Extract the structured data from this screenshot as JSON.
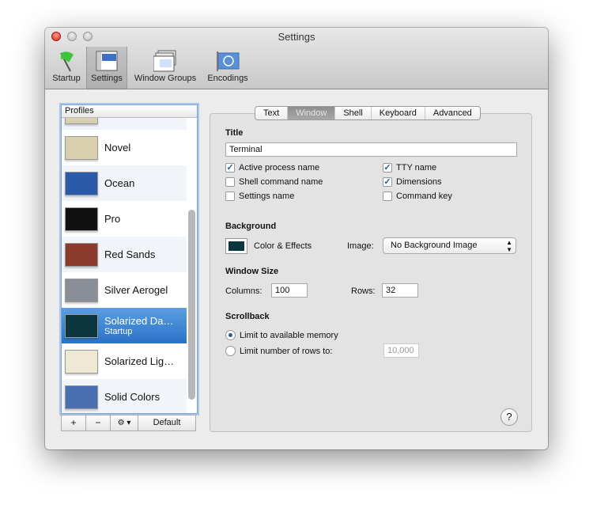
{
  "window": {
    "title": "Settings"
  },
  "toolbar": [
    {
      "label": "Startup",
      "icon": "flag-icon"
    },
    {
      "label": "Settings",
      "icon": "settings-icon",
      "selected": true
    },
    {
      "label": "Window Groups",
      "icon": "window-groups-icon"
    },
    {
      "label": "Encodings",
      "icon": "un-flag-icon"
    }
  ],
  "profiles": {
    "header": "Profiles",
    "items": [
      {
        "name": "",
        "color": "#d8cfae"
      },
      {
        "name": "Novel",
        "color": "#d8cfae"
      },
      {
        "name": "Ocean",
        "color": "#2b5aa8"
      },
      {
        "name": "Pro",
        "color": "#111111"
      },
      {
        "name": "Red Sands",
        "color": "#8c3a2b"
      },
      {
        "name": "Silver Aerogel",
        "color": "#8a8e96"
      },
      {
        "name": "Solarized Da…",
        "sub": "Startup",
        "color": "#0b3640",
        "selected": true
      },
      {
        "name": "Solarized Lig…",
        "color": "#eee8d5"
      },
      {
        "name": "Solid Colors",
        "color": "#4a6fb0"
      }
    ],
    "buttons": {
      "add": "+",
      "remove": "−",
      "gear": "⚙ ▾",
      "default": "Default"
    }
  },
  "tabs": [
    {
      "label": "Text"
    },
    {
      "label": "Window",
      "selected": true
    },
    {
      "label": "Shell"
    },
    {
      "label": "Keyboard"
    },
    {
      "label": "Advanced"
    }
  ],
  "window_tab": {
    "title_heading": "Title",
    "title_value": "Terminal",
    "checks": [
      {
        "label": "Active process name",
        "checked": true
      },
      {
        "label": "Shell command name",
        "checked": false
      },
      {
        "label": "Settings name",
        "checked": false
      },
      {
        "label": "TTY name",
        "checked": true
      },
      {
        "label": "Dimensions",
        "checked": true
      },
      {
        "label": "Command key",
        "checked": false
      }
    ],
    "background_heading": "Background",
    "color_effects": "Color & Effects",
    "swatch_color": "#0b3640",
    "image_label": "Image:",
    "image_value": "No Background Image",
    "size_heading": "Window Size",
    "columns_label": "Columns:",
    "columns": "100",
    "rows_label": "Rows:",
    "rows": "32",
    "scrollback_heading": "Scrollback",
    "scroll_opt1": "Limit to available memory",
    "scroll_opt2": "Limit number of rows to:",
    "scroll_rows": "10,000",
    "help": "?"
  }
}
